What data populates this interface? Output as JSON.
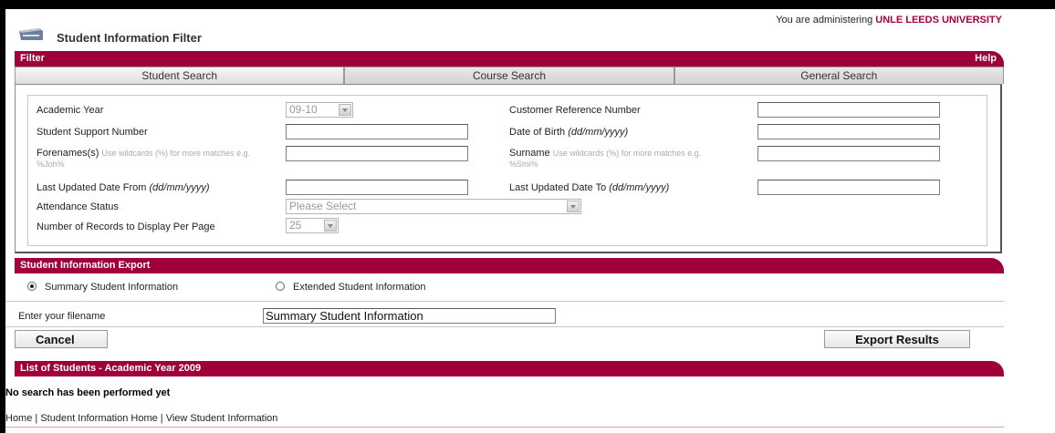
{
  "header": {
    "admin_prefix": "You are administering",
    "admin_org": "UNLE LEEDS UNIVERSITY",
    "page_title": "Student Information Filter"
  },
  "filter": {
    "band_label": "Filter",
    "help_label": "Help",
    "tabs": [
      "Student Search",
      "Course Search",
      "General Search"
    ],
    "active_tab": "Student Search"
  },
  "form": {
    "academic_year_label": "Academic Year",
    "academic_year_value": "09-10",
    "crn_label": "Customer Reference Number",
    "ssn_label": "Student Support Number",
    "dob_label": "Date of Birth",
    "dob_format": "(dd/mm/yyyy)",
    "forenames_label": "Forenames(s)",
    "forenames_hint": "Use wildcards (%) for more matches e.g. %Joh%",
    "surname_label": "Surname",
    "surname_hint": "Use wildcards (%) for more matches e.g. %Smi%",
    "updated_from_label": "Last Updated Date From",
    "updated_from_format": "(dd/mm/yyyy)",
    "updated_to_label": "Last Updated Date To",
    "updated_to_format": "(dd/mm/yyyy)",
    "attendance_label": "Attendance Status",
    "attendance_value": "Please Select",
    "records_label": "Number of Records to Display Per Page",
    "records_value": "25"
  },
  "export": {
    "band_label": "Student Information Export",
    "option_summary": "Summary Student Information",
    "option_extended": "Extended Student Information",
    "selected": "summary",
    "filename_label": "Enter your filename",
    "filename_value": "Summary Student Information",
    "cancel_label": "Cancel",
    "export_label": "Export Results"
  },
  "results": {
    "band_label": "List of Students - Academic Year 2009",
    "empty_message": "No search has been performed yet"
  },
  "footer": {
    "links": [
      "Home",
      "Student Information Home",
      "View Student Information"
    ],
    "separator": "|"
  },
  "colors": {
    "accent": "#a0003a",
    "admin_org": "#a8003c"
  }
}
